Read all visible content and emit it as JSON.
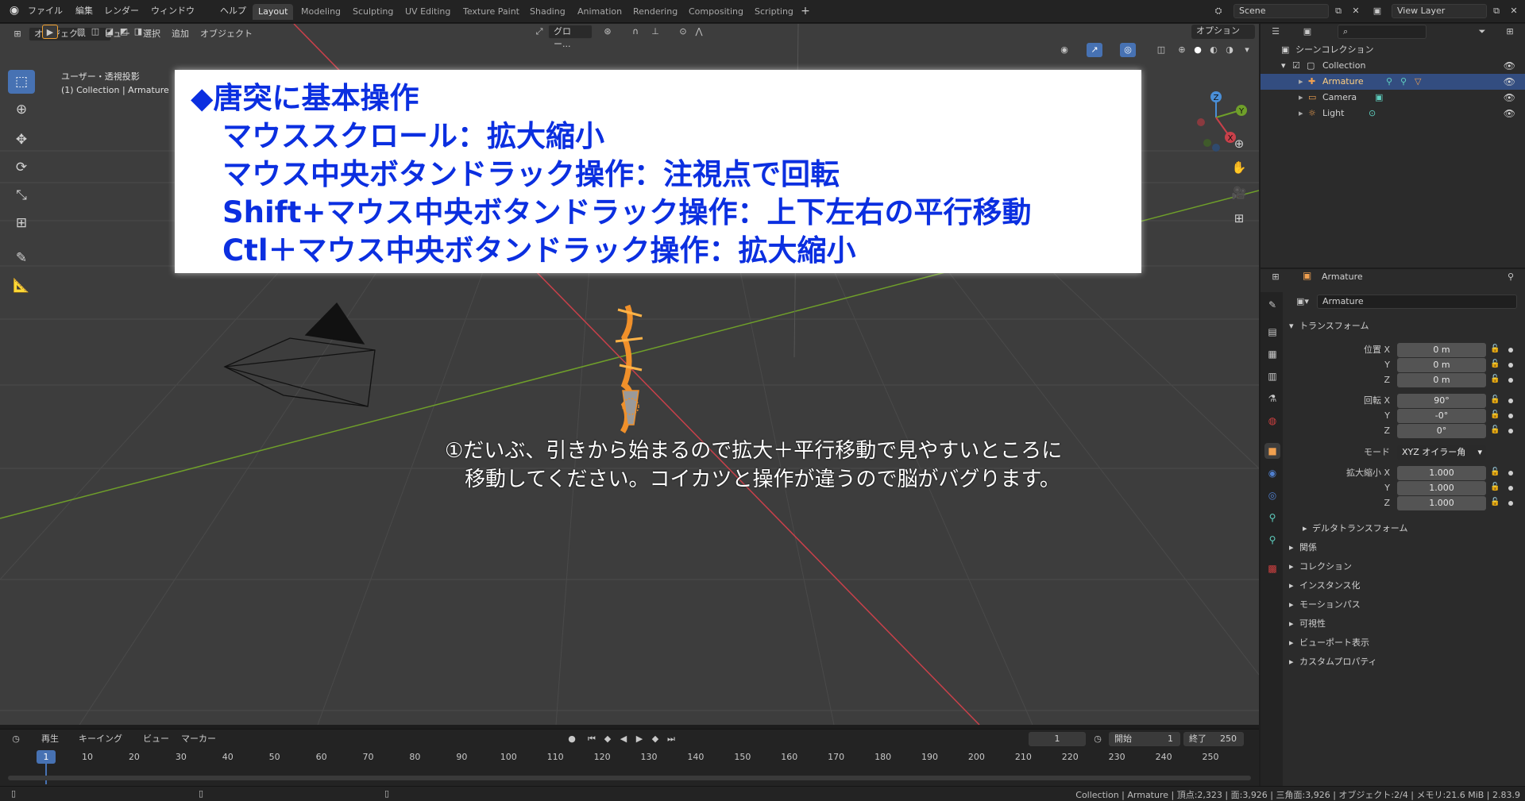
{
  "top_menu": [
    "ファイル",
    "編集",
    "レンダー",
    "ウィンドウ",
    "ヘルプ"
  ],
  "workspace_tabs": [
    "Layout",
    "Modeling",
    "Sculpting",
    "UV Editing",
    "Texture Paint",
    "Shading",
    "Animation",
    "Rendering",
    "Compositing",
    "Scripting"
  ],
  "active_workspace": "Layout",
  "scene": "Scene",
  "view_layer": "View Layer",
  "viewport_header": {
    "mode": "オブジェク...",
    "menu": [
      "ビュー",
      "選択",
      "追加",
      "オブジェクト"
    ],
    "transform_orientation": "グロー...",
    "options": "オプション"
  },
  "viewport_info": {
    "view": "ユーザー・透視投影",
    "context": "(1) Collection | Armature"
  },
  "instruction_box": [
    "◆唐突に基本操作",
    "マウススクロール：拡大縮小",
    "マウス中央ボタンドラック操作：注視点で回転",
    "Shift+マウス中央ボタンドラック操作：上下左右の平行移動",
    "Ctl＋マウス中央ボタンドラック操作：拡大縮小"
  ],
  "note": [
    "①だいぶ、引きから始まるので拡大＋平行移動で見やすいところに",
    "移動してください。コイカツと操作が違うので脳がバグります。"
  ],
  "gizmo_axes": [
    "Z",
    "Y",
    "X"
  ],
  "outliner": {
    "root": "シーンコレクション",
    "items": [
      {
        "label": "Collection",
        "depth": 1,
        "selected": false
      },
      {
        "label": "Armature",
        "depth": 2,
        "selected": true
      },
      {
        "label": "Camera",
        "depth": 2,
        "selected": false
      },
      {
        "label": "Light",
        "depth": 2,
        "selected": false
      }
    ]
  },
  "properties": {
    "object_name": "Armature",
    "name_field": "Armature",
    "transform_header": "トランスフォーム",
    "location_label": "位置 X",
    "location": [
      "0 m",
      "0 m",
      "0 m"
    ],
    "rotation_label": "回転 X",
    "rotation": [
      "90°",
      "-0°",
      "0°"
    ],
    "mode_label": "モード",
    "mode": "XYZ オイラー角",
    "scale_label": "拡大縮小 X",
    "scale": [
      "1.000",
      "1.000",
      "1.000"
    ],
    "axis_y": "Y",
    "axis_z": "Z",
    "delta": "デルタトランスフォーム",
    "panels": [
      "関係",
      "コレクション",
      "インスタンス化",
      "モーションパス",
      "可視性",
      "ビューポート表示",
      "カスタムプロパティ"
    ]
  },
  "timeline": {
    "menu": [
      "再生",
      "キーイング",
      "ビュー",
      "マーカー"
    ],
    "current_frame": "1",
    "frame_field": "1",
    "start_label": "開始",
    "start": "1",
    "end_label": "終了",
    "end": "250",
    "ticks": [
      "1",
      "10",
      "20",
      "30",
      "40",
      "50",
      "60",
      "70",
      "80",
      "90",
      "100",
      "110",
      "120",
      "130",
      "140",
      "150",
      "160",
      "170",
      "180",
      "190",
      "200",
      "210",
      "220",
      "230",
      "240",
      "250"
    ]
  },
  "status": "Collection | Armature | 頂点:2,323 | 面:3,926 | 三角面:3,926 | オブジェクト:2/4 | メモリ:21.6 MiB | 2.83.9",
  "colors": {
    "accent": "#4772b3",
    "selection": "#334d80",
    "x_axis": "#c9404a",
    "y_axis": "#6f9f2a",
    "info_text": "#0b2fe0"
  }
}
